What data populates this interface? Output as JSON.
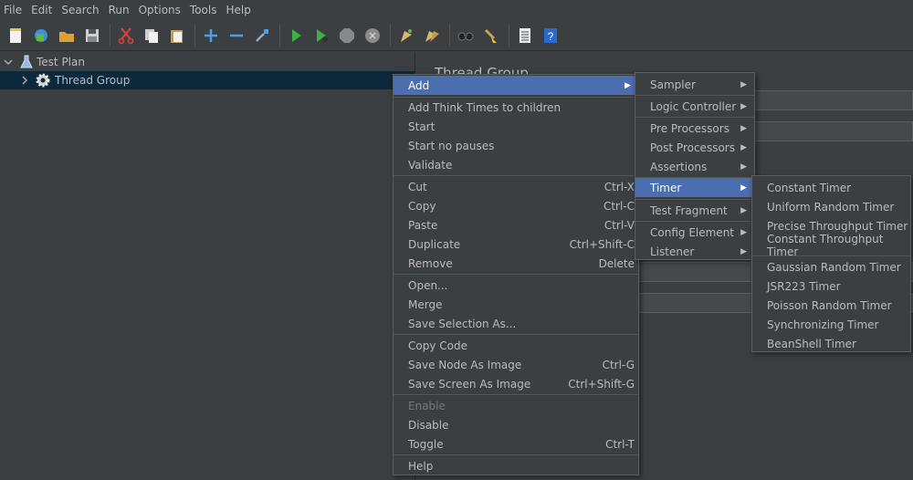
{
  "menubar": {
    "file": "File",
    "edit": "Edit",
    "search": "Search",
    "run": "Run",
    "options": "Options",
    "tools": "Tools",
    "help": "Help"
  },
  "tree": {
    "test_plan": "Test Plan",
    "thread_group": "Thread Group"
  },
  "panel": {
    "title": "Thread Group"
  },
  "context_menu": {
    "add": "Add",
    "add_think_times": "Add Think Times to children",
    "start": "Start",
    "start_no_pauses": "Start no pauses",
    "validate": "Validate",
    "cut": "Cut",
    "cut_acc": "Ctrl-X",
    "copy": "Copy",
    "copy_acc": "Ctrl-C",
    "paste": "Paste",
    "paste_acc": "Ctrl-V",
    "duplicate": "Duplicate",
    "duplicate_acc": "Ctrl+Shift-C",
    "remove": "Remove",
    "remove_acc": "Delete",
    "open": "Open...",
    "merge": "Merge",
    "save_selection_as": "Save Selection As...",
    "copy_code": "Copy Code",
    "save_node_as_image": "Save Node As Image",
    "save_node_acc": "Ctrl-G",
    "save_screen_as_image": "Save Screen As Image",
    "save_screen_acc": "Ctrl+Shift-G",
    "enable": "Enable",
    "disable": "Disable",
    "toggle": "Toggle",
    "toggle_acc": "Ctrl-T",
    "help": "Help"
  },
  "add_menu": {
    "sampler": "Sampler",
    "logic_controller": "Logic Controller",
    "pre_processors": "Pre Processors",
    "post_processors": "Post Processors",
    "assertions": "Assertions",
    "timer": "Timer",
    "test_fragment": "Test Fragment",
    "config_element": "Config Element",
    "listener": "Listener"
  },
  "timer_menu": {
    "constant_timer": "Constant Timer",
    "uniform_random_timer": "Uniform Random Timer",
    "precise_throughput_timer": "Precise Throughput Timer",
    "constant_throughput_timer": "Constant Throughput Timer",
    "gaussian_random_timer": "Gaussian Random Timer",
    "jsr223_timer": "JSR223 Timer",
    "poisson_random_timer": "Poisson Random Timer",
    "synchronizing_timer": "Synchronizing Timer",
    "beanshell_timer": "BeanShell Timer"
  },
  "colors": {
    "background": "#3c3f41",
    "highlight": "#4b6eaf",
    "selection": "#0d293e",
    "text": "#bbbbbb"
  }
}
